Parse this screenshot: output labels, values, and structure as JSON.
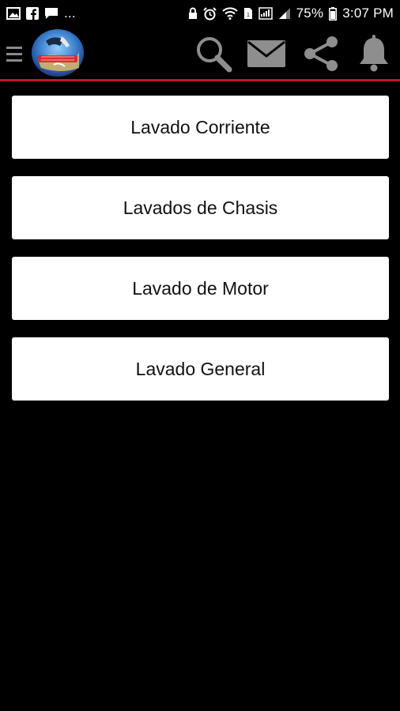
{
  "status_bar": {
    "left_icons": [
      "image-icon",
      "facebook-icon",
      "chat-icon"
    ],
    "more": "...",
    "right_icons": [
      "lock-icon",
      "alarm-icon",
      "wifi-icon",
      "sim-icon",
      "data-icon",
      "signal-icon",
      "battery-icon"
    ],
    "battery": "75%",
    "time": "3:07 PM"
  },
  "app_bar": {
    "menu_icon": "hamburger-menu-icon",
    "logo_alt": "app-logo",
    "actions": [
      "search-icon",
      "mail-icon",
      "share-icon",
      "bell-icon"
    ],
    "accent_color": "#c0161e"
  },
  "menu": {
    "items": [
      {
        "label": "Lavado Corriente"
      },
      {
        "label": "Lavados de Chasis"
      },
      {
        "label": "Lavado de Motor"
      },
      {
        "label": "Lavado General"
      }
    ]
  }
}
